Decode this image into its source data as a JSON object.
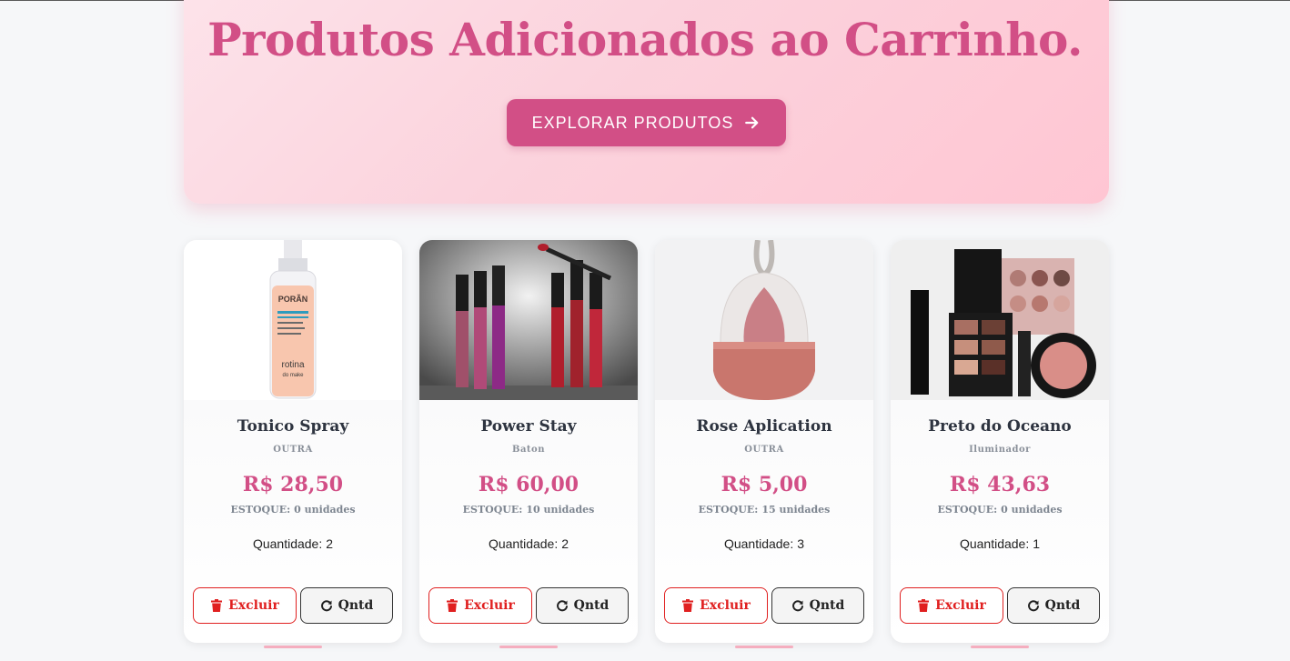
{
  "hero": {
    "title": "Produtos Adicionados ao Carrinho.",
    "button_label": "EXPLORAR PRODUTOS",
    "button_icon": "arrow-right-icon"
  },
  "labels": {
    "stock_prefix": "ESTOQUE:",
    "quantity_prefix": "Quantidade:",
    "delete_label": "Excluir",
    "qty_button_label": "Qntd",
    "delete_icon": "trash-icon",
    "qty_icon": "refresh-icon"
  },
  "products": [
    {
      "name": "Tonico Spray",
      "category": "OUTRA",
      "price": "R$ 28,50",
      "stock": "0 unidades",
      "quantity": "2"
    },
    {
      "name": "Power Stay",
      "category": "Baton",
      "price": "R$ 60,00",
      "stock": "10 unidades",
      "quantity": "2"
    },
    {
      "name": "Rose Aplication",
      "category": "OUTRA",
      "price": "R$ 5,00",
      "stock": "15 unidades",
      "quantity": "3"
    },
    {
      "name": "Preto do Oceano",
      "category": "Iluminador",
      "price": "R$ 43,63",
      "stock": "0 unidades",
      "quantity": "1"
    }
  ],
  "colors": {
    "accent": "#d24f86",
    "danger": "#e02020",
    "hero_bg": "#fcd3dd",
    "page_bg": "#f6f7f9"
  }
}
